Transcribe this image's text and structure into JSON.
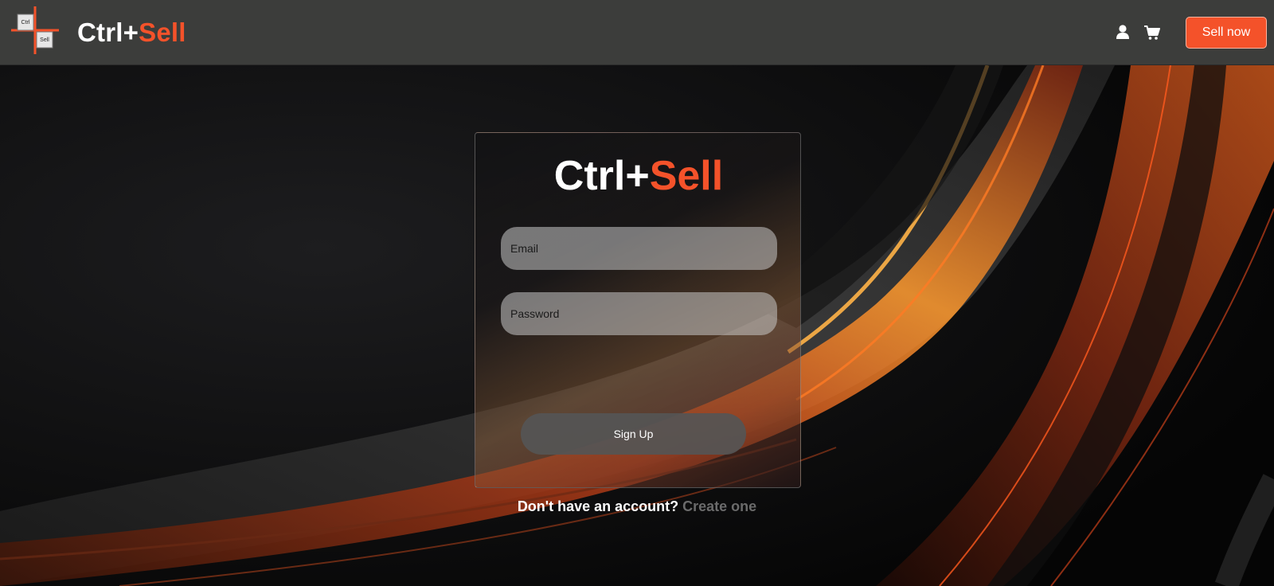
{
  "header": {
    "brand_white": "Ctrl+",
    "brand_orange": "Sell",
    "logo_key_top": "Ctrl",
    "logo_key_bottom": "Sell",
    "icons": [
      "user-icon",
      "cart-icon"
    ],
    "sell_button_label": "Sell now"
  },
  "login": {
    "title_white": "Ctrl+",
    "title_orange": "Sell",
    "email_placeholder": "Email",
    "email_value": "",
    "password_placeholder": "Password",
    "password_value": "",
    "submit_label": "Sign Up"
  },
  "footer_prompt": {
    "text": "Don't have an account?",
    "link_label": "Create one"
  },
  "colors": {
    "accent": "#f4522a",
    "header_bg": "#3c3d3b",
    "background": "#0b0b0c",
    "link_muted": "#6b6b6b"
  }
}
